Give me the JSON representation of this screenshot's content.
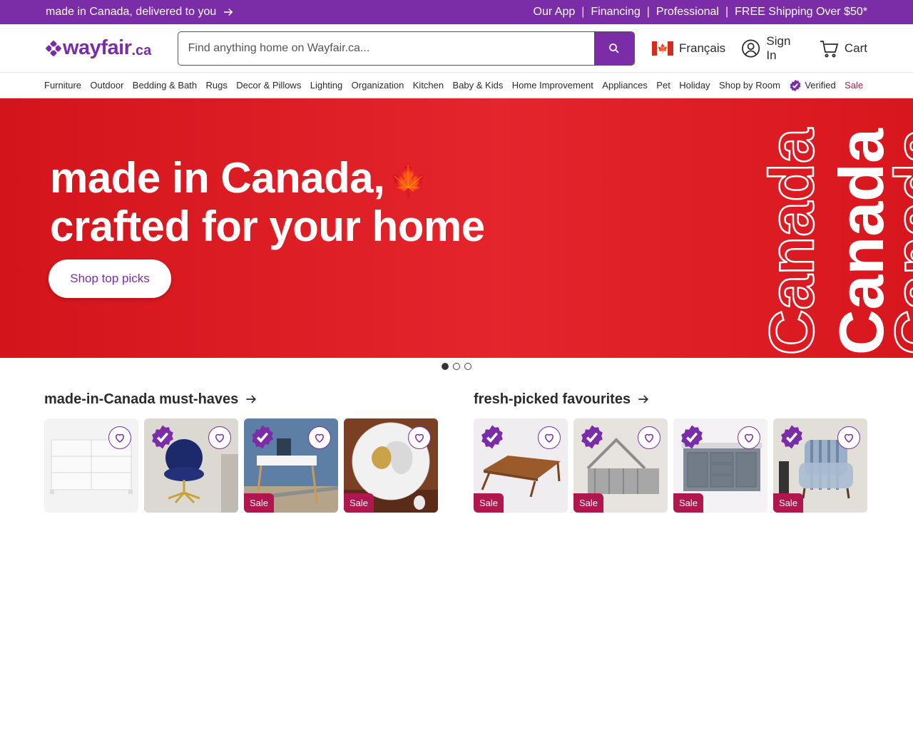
{
  "promo": {
    "left_text": "made in Canada, delivered to you",
    "links": [
      "Our App",
      "Financing",
      "Professional",
      "FREE Shipping Over $50*"
    ],
    "separator": "|"
  },
  "header": {
    "logo_word": "wayfair",
    "logo_tld": ".ca",
    "search_placeholder": "Find anything home on Wayfair.ca...",
    "language": "Français",
    "sign_in": "Sign In",
    "cart": "Cart"
  },
  "nav": {
    "items": [
      "Furniture",
      "Outdoor",
      "Bedding & Bath",
      "Rugs",
      "Decor & Pillows",
      "Lighting",
      "Organization",
      "Kitchen",
      "Baby & Kids",
      "Home Improvement",
      "Appliances",
      "Pet",
      "Holiday",
      "Shop by Room"
    ],
    "verified": "Verified",
    "sale": "Sale"
  },
  "hero": {
    "line1": "made in Canada,",
    "line2": "crafted for your home",
    "cta": "Shop top picks",
    "vertical_word": "Canada"
  },
  "sections": [
    {
      "title": "made-in-Canada must-haves",
      "cards": [
        {
          "sale": "",
          "verified": false
        },
        {
          "sale": "",
          "verified": true
        },
        {
          "sale": "Sale",
          "verified": true
        },
        {
          "sale": "Sale",
          "verified": false
        }
      ]
    },
    {
      "title": "fresh-picked favourites",
      "cards": [
        {
          "sale": "Sale",
          "verified": true
        },
        {
          "sale": "Sale",
          "verified": true
        },
        {
          "sale": "Sale",
          "verified": true
        },
        {
          "sale": "Sale",
          "verified": true
        }
      ]
    }
  ],
  "colors": {
    "brand": "#7b2da8",
    "sale": "#b0174e",
    "hero_red": "#e4252c"
  }
}
